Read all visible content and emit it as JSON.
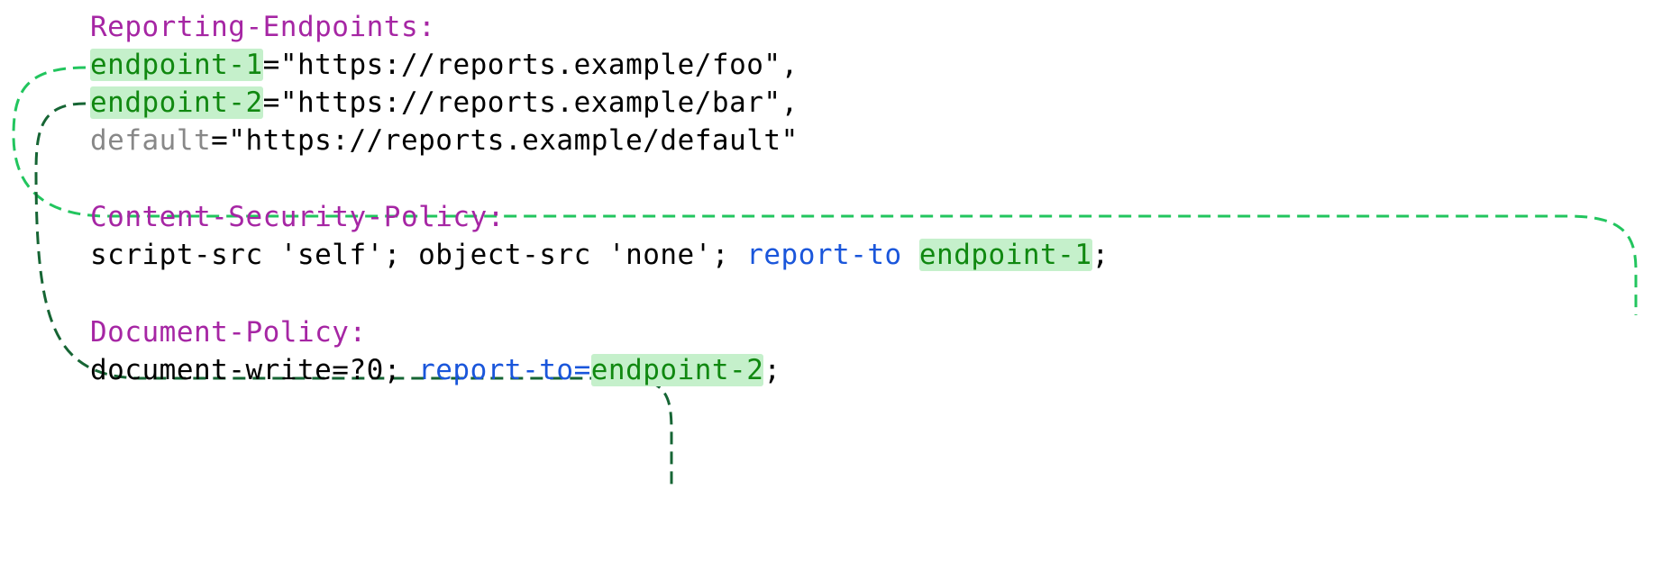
{
  "headers": {
    "reporting_endpoints": {
      "name": "Reporting-Endpoints:",
      "endpoints": [
        {
          "key": "endpoint-1",
          "eq": "=",
          "value": "\"https://reports.example/foo\"",
          "sep": ","
        },
        {
          "key": "endpoint-2",
          "eq": "=",
          "value": "\"https://reports.example/bar\"",
          "sep": ","
        },
        {
          "key": "default",
          "eq": "=",
          "value": "\"https://reports.example/default\"",
          "sep": ""
        }
      ]
    },
    "csp": {
      "name": "Content-Security-Policy:",
      "prefix": "script-src 'self'; object-src 'none'; ",
      "report_to": "report-to",
      "sep": " ",
      "endpoint": "endpoint-1",
      "suffix": ";"
    },
    "dp": {
      "name": "Document-Policy:",
      "prefix": "document-write=?0; ",
      "report_to": "report-to=",
      "endpoint": "endpoint-2",
      "suffix": ";"
    }
  }
}
